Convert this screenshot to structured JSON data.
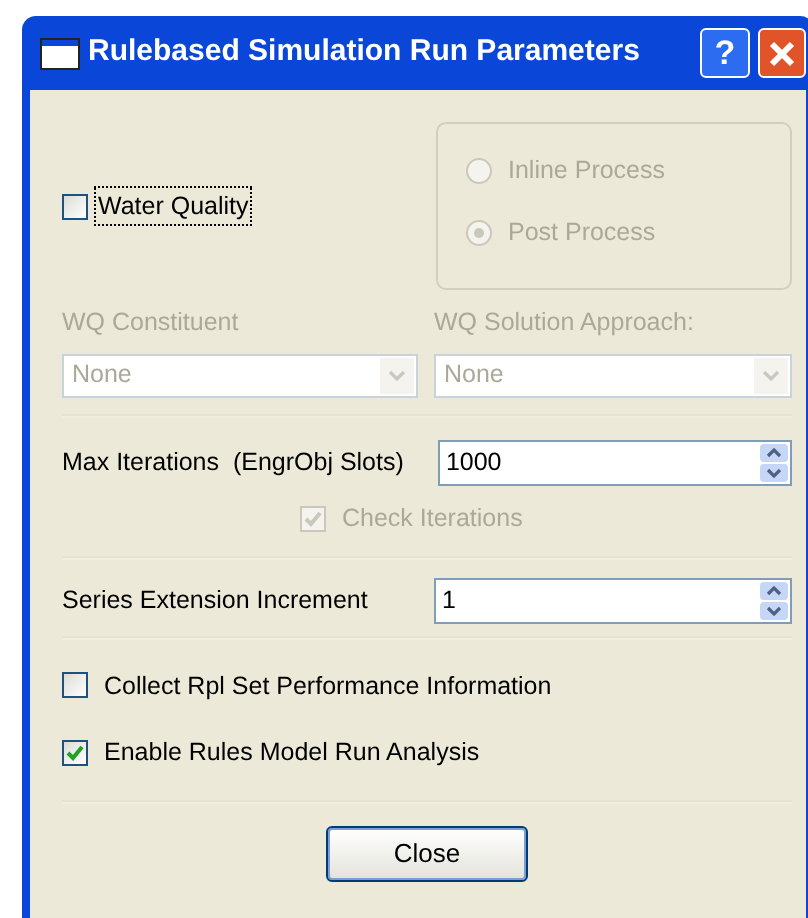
{
  "window": {
    "title": "Rulebased Simulation Run Parameters",
    "help_button": "?"
  },
  "water_quality": {
    "label": "Water Quality",
    "checked": false,
    "focused": true
  },
  "process_options": {
    "disabled": true,
    "options": [
      {
        "label": "Inline Process",
        "selected": false
      },
      {
        "label": "Post Process",
        "selected": true
      }
    ]
  },
  "dropdowns": [
    {
      "label": "WQ Constituent",
      "value": "None",
      "disabled": true
    },
    {
      "label": "WQ Solution Approach:",
      "value": "None",
      "disabled": true
    }
  ],
  "max_iterations": {
    "label": "Max Iterations  (EngrObj Slots)",
    "value": "1000"
  },
  "check_iterations": {
    "label": "Check Iterations",
    "checked": true,
    "disabled": true
  },
  "series_extension": {
    "label": "Series Extension Increment",
    "value": "1"
  },
  "options": [
    {
      "label": "Collect Rpl Set Performance Information",
      "checked": false
    },
    {
      "label": "Enable Rules Model Run Analysis",
      "checked": true
    }
  ],
  "close_button": "Close"
}
